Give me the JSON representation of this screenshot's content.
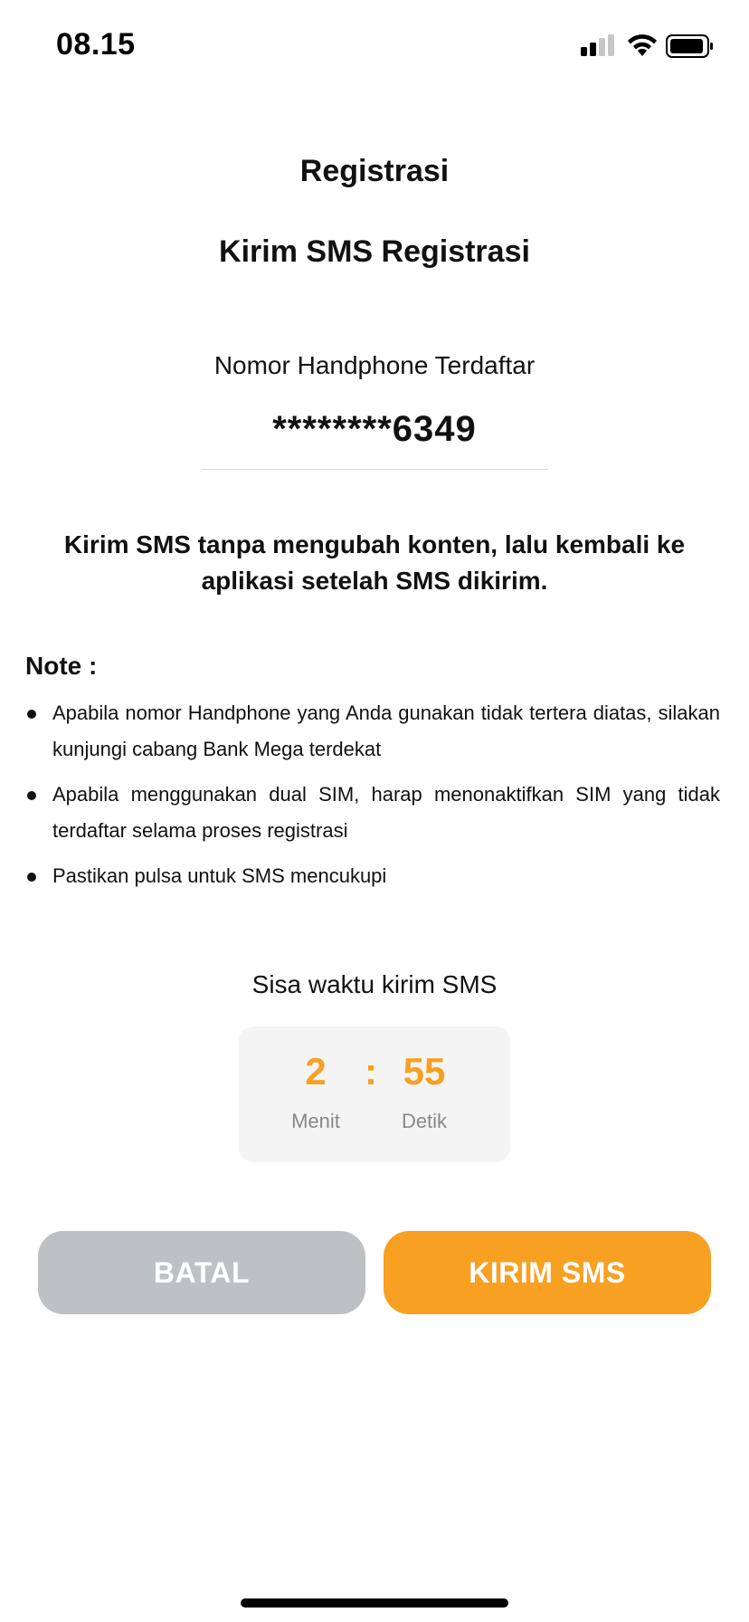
{
  "status_bar": {
    "time": "08.15",
    "icons": [
      "signal-icon",
      "wifi-icon",
      "battery-icon"
    ]
  },
  "header": {
    "title": "Registrasi",
    "subtitle": "Kirim SMS Registrasi"
  },
  "phone": {
    "label": "Nomor Handphone Terdaftar",
    "value": "********6349"
  },
  "instruction": "Kirim SMS tanpa mengubah konten, lalu kembali ke aplikasi setelah SMS dikirim.",
  "note": {
    "title": "Note :",
    "items": [
      "Apabila nomor Handphone yang Anda gunakan tidak tertera diatas, silakan kunjungi cabang Bank Mega terdekat",
      "Apabila menggunakan dual SIM, harap menonaktifkan SIM yang tidak terdaftar selama proses registrasi",
      "Pastikan pulsa untuk SMS mencukupi"
    ]
  },
  "timer": {
    "label": "Sisa waktu kirim SMS",
    "minutes": "2",
    "separator": ":",
    "seconds": "55",
    "minutes_unit": "Menit",
    "seconds_unit": "Detik"
  },
  "buttons": {
    "cancel_label": "BATAL",
    "send_label": "KIRIM SMS"
  },
  "colors": {
    "accent": "#f7a021",
    "cancel_button": "#bec1c3",
    "timer_box": "#f4f4f4"
  }
}
